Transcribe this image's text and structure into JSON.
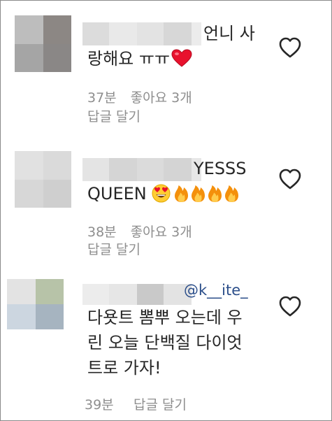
{
  "comments": [
    {
      "text_line1": "언니 사",
      "text_line2": "랑해요 ㅠㅠ",
      "emojis": [
        "red-heart"
      ],
      "time": "37분",
      "likes": "좋아요 3개",
      "reply_label": "답글 달기"
    },
    {
      "text_line1": "YESSS",
      "text_line2": "QUEEN",
      "emojis": [
        "heart-eyes-face",
        "fire",
        "fire",
        "fire",
        "fire"
      ],
      "time": "38분",
      "likes": "좋아요 3개",
      "reply_label": "답글 달기"
    },
    {
      "mention": "@k__ite_",
      "text_line1": "다욧트 뽐뿌 오는데 우",
      "text_line2": "린 오늘 단백질 다이엇",
      "text_line3": "트로 가자!",
      "time": "39분",
      "reply_label": "답글 달기"
    }
  ],
  "colors": {
    "text": "#262626",
    "meta": "#8e8e8e",
    "mention": "#2b4e8a",
    "heart_red": "#e8112d",
    "fire": "#f4900c"
  }
}
